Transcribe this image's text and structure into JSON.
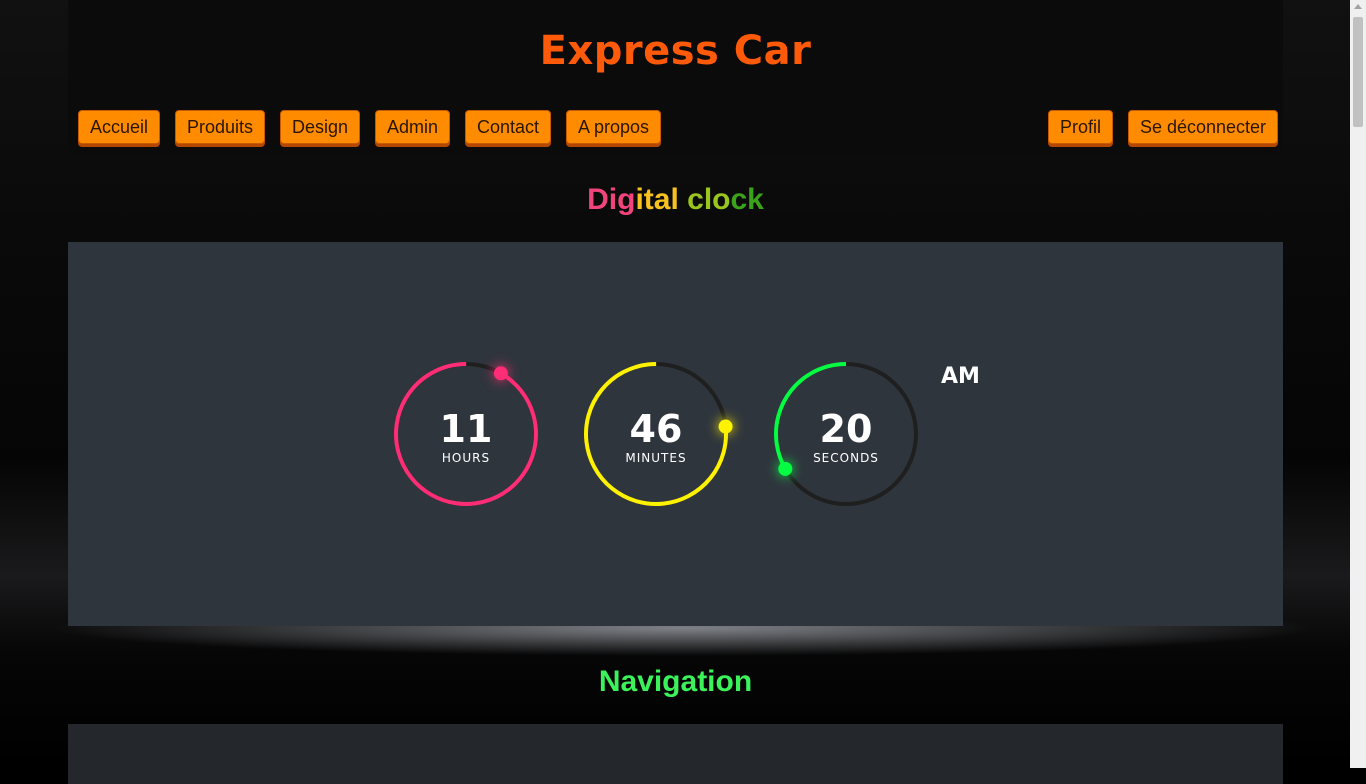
{
  "site": {
    "brand": "Express Car"
  },
  "nav": {
    "left": [
      "Accueil",
      "Produits",
      "Design",
      "Admin",
      "Contact",
      "A propos"
    ],
    "right": [
      "Profil",
      "Se déconnecter"
    ]
  },
  "clock_section": {
    "title_parts": [
      "Dig",
      "ital",
      " clo",
      "ck"
    ],
    "hours": {
      "value": "11",
      "label": "HOURS",
      "color": "#ff2d75",
      "fraction": 0.917
    },
    "minutes": {
      "value": "46",
      "label": "MINUTES",
      "color": "#fff200",
      "fraction": 0.767
    },
    "seconds": {
      "value": "20",
      "label": "SECONDS",
      "color": "#04fc43",
      "fraction": 0.333
    },
    "period": "AM",
    "track_color": "#1f1f1f"
  },
  "navigation_section": {
    "title": "Navigation"
  }
}
